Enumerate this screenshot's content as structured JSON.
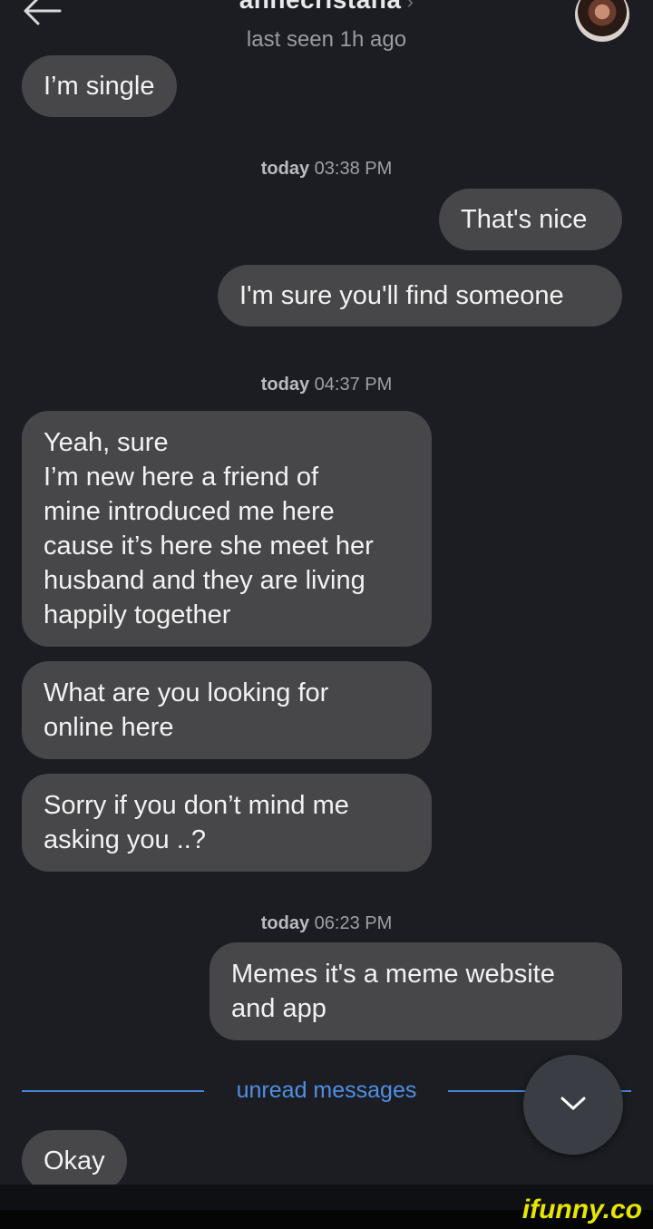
{
  "header": {
    "contact_name": "annecristana",
    "status": "last seen 1h ago"
  },
  "messages": {
    "m1": "I’m single",
    "ts1_day": "today",
    "ts1_time": "03:38 PM",
    "m2": "That's nice",
    "m3": "I'm sure you'll find someone",
    "ts2_day": "today",
    "ts2_time": "04:37 PM",
    "m4_lines": [
      "Yeah, sure",
      "I’m new here a friend of",
      "mine introduced me here",
      "cause it’s here she meet her",
      "husband and they are living",
      "happily together"
    ],
    "m5_lines": [
      "What are you looking for",
      "online here"
    ],
    "m6_lines": [
      "Sorry if you don’t mind me",
      "asking you ..?"
    ],
    "ts3_day": "today",
    "ts3_time": "06:23 PM",
    "m7_lines": [
      "Memes it's a meme website",
      "and app"
    ],
    "unread_label": "unread messages",
    "m8": "Okay"
  },
  "watermark": "ifunny.co",
  "colors": {
    "background": "#1c1d22",
    "bubble": "#474749",
    "accent": "#4f8fe6"
  },
  "icons": {
    "back": "back-arrow-icon",
    "scroll": "chevron-down-icon"
  }
}
